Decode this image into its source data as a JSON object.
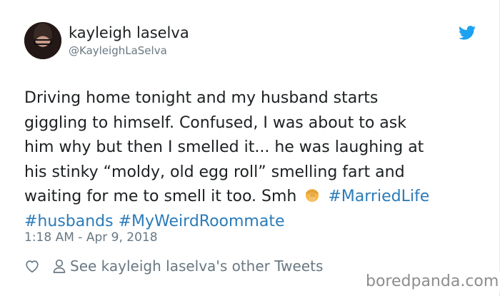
{
  "author": {
    "name": "kayleigh laselva",
    "handle": "@KayleighLaSelva"
  },
  "tweet": {
    "line1": "Driving home tonight and my husband starts",
    "line2": "giggling to himself. Confused, I was about to ask",
    "line3": "him why but then I smelled it... he was laughing at",
    "line4": "his stinky “moldy, old egg roll” smelling fart and",
    "line5_text": "waiting for me to smell it too. Smh ",
    "emoji": "woman-facepalming-emoji",
    "hashtags": [
      "#MarriedLife",
      "#husbands",
      "#MyWeirdRoommate"
    ]
  },
  "timestamp": "1:18 AM - Apr 9, 2018",
  "actions": {
    "other_tweets_label": "See kayleigh laselva's other Tweets"
  },
  "watermark": "boredpanda.com",
  "colors": {
    "link": "#2b7bb9",
    "muted": "#697882",
    "twitter_blue": "#1da1f2"
  },
  "icons": [
    "twitter-bird-icon",
    "heart-icon",
    "person-icon"
  ]
}
